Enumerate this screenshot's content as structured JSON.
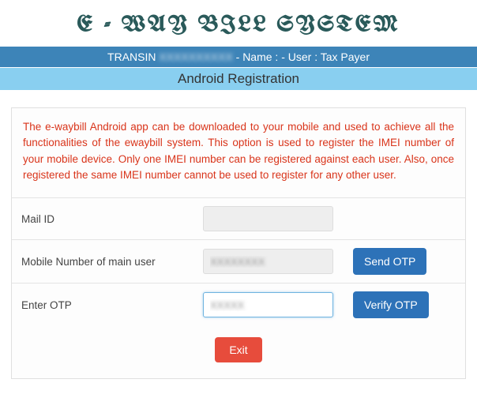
{
  "header": {
    "title": "E - WAY BILL SYSTEM"
  },
  "infoBar": {
    "prefix": "TRANSIN",
    "masked": "XXXXXXXXXX",
    "suffix": "- Name : - User : Tax Payer"
  },
  "subHeader": {
    "title": "Android Registration"
  },
  "description": "The e-waybill Android app can be downloaded to your mobile and used to achieve all the functionalities of the ewaybill system. This option is used to register the IMEI number of your mobile device. Only one IMEI number can be registered against each user. Also, once registered the same IMEI number cannot be used to register for any other user.",
  "form": {
    "mailId": {
      "label": "Mail ID",
      "value": ""
    },
    "mobile": {
      "label": "Mobile Number of main user",
      "value": "XXXXXXXX",
      "button": "Send OTP"
    },
    "otp": {
      "label": "Enter OTP",
      "value": "XXXXX",
      "button": "Verify OTP"
    },
    "exit": {
      "label": "Exit"
    }
  }
}
